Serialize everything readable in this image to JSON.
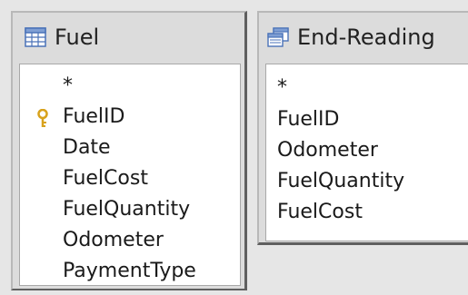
{
  "tables": [
    {
      "id": "fuel",
      "title": "Fuel",
      "icon": "table-icon",
      "fields": [
        "*",
        "FuelID",
        "Date",
        "FuelCost",
        "FuelQuantity",
        "Odometer",
        "PaymentType"
      ],
      "primary_key_field": "FuelID"
    },
    {
      "id": "end-reading",
      "title": "End-Reading",
      "icon": "query-icon",
      "fields": [
        "*",
        "FuelID",
        "Odometer",
        "FuelQuantity",
        "FuelCost"
      ]
    }
  ],
  "colors": {
    "icon_blue": "#4a72b8",
    "key_gold": "#d8a21c",
    "window_bg": "#dcdcdc"
  }
}
